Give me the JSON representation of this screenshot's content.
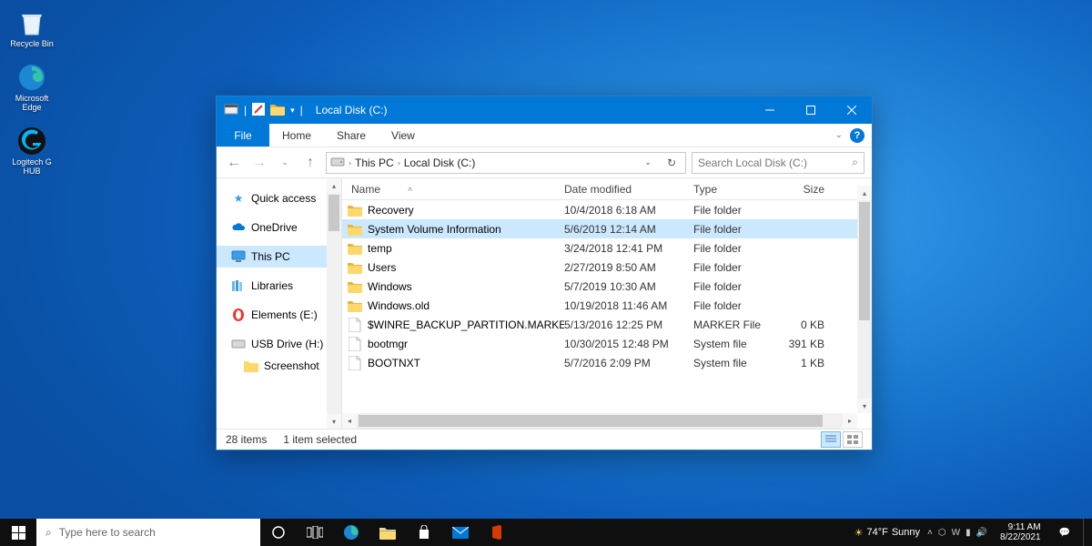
{
  "desktop": {
    "icons": [
      {
        "id": "recycle-bin",
        "label": "Recycle Bin"
      },
      {
        "id": "microsoft-edge",
        "label": "Microsoft Edge"
      },
      {
        "id": "logitech-g-hub",
        "label": "Logitech G HUB"
      }
    ]
  },
  "window": {
    "title": "Local Disk (C:)",
    "menubar": {
      "file": "File",
      "tabs": [
        "Home",
        "Share",
        "View"
      ]
    },
    "breadcrumbs": [
      "This PC",
      "Local Disk (C:)"
    ],
    "search_placeholder": "Search Local Disk (C:)",
    "columns": {
      "name": "Name",
      "date": "Date modified",
      "type": "Type",
      "size": "Size"
    },
    "sidebar": [
      {
        "id": "quick-access",
        "label": "Quick access",
        "icon": "star"
      },
      {
        "id": "onedrive",
        "label": "OneDrive",
        "icon": "cloud"
      },
      {
        "id": "this-pc",
        "label": "This PC",
        "icon": "monitor",
        "active": true
      },
      {
        "id": "libraries",
        "label": "Libraries",
        "icon": "libraries"
      },
      {
        "id": "elements-e",
        "label": "Elements (E:)",
        "icon": "opera"
      },
      {
        "id": "usb-drive",
        "label": "USB Drive (H:)",
        "icon": "drive"
      },
      {
        "id": "screenshot",
        "label": "Screenshot",
        "icon": "folder",
        "child": true
      }
    ],
    "files": [
      {
        "name": "Recovery",
        "date": "10/4/2018 6:18 AM",
        "type": "File folder",
        "size": "",
        "kind": "folder"
      },
      {
        "name": "System Volume Information",
        "date": "5/6/2019 12:14 AM",
        "type": "File folder",
        "size": "",
        "kind": "folder",
        "selected": true
      },
      {
        "name": "temp",
        "date": "3/24/2018 12:41 PM",
        "type": "File folder",
        "size": "",
        "kind": "folder"
      },
      {
        "name": "Users",
        "date": "2/27/2019 8:50 AM",
        "type": "File folder",
        "size": "",
        "kind": "folder"
      },
      {
        "name": "Windows",
        "date": "5/7/2019 10:30 AM",
        "type": "File folder",
        "size": "",
        "kind": "folder"
      },
      {
        "name": "Windows.old",
        "date": "10/19/2018 11:46 AM",
        "type": "File folder",
        "size": "",
        "kind": "folder"
      },
      {
        "name": "$WINRE_BACKUP_PARTITION.MARKER",
        "date": "5/13/2016 12:25 PM",
        "type": "MARKER File",
        "size": "0 KB",
        "kind": "file"
      },
      {
        "name": "bootmgr",
        "date": "10/30/2015 12:48 PM",
        "type": "System file",
        "size": "391 KB",
        "kind": "file"
      },
      {
        "name": "BOOTNXT",
        "date": "5/7/2016 2:09 PM",
        "type": "System file",
        "size": "1 KB",
        "kind": "file"
      }
    ],
    "status": {
      "count": "28 items",
      "selection": "1 item selected"
    }
  },
  "taskbar": {
    "search_placeholder": "Type here to search",
    "pinned": [
      "cortana",
      "task-view",
      "edge",
      "file-explorer",
      "store",
      "mail",
      "office"
    ],
    "weather": {
      "temp": "74°F",
      "cond": "Sunny"
    },
    "clock": {
      "time": "9:11 AM",
      "date": "8/22/2021"
    }
  }
}
